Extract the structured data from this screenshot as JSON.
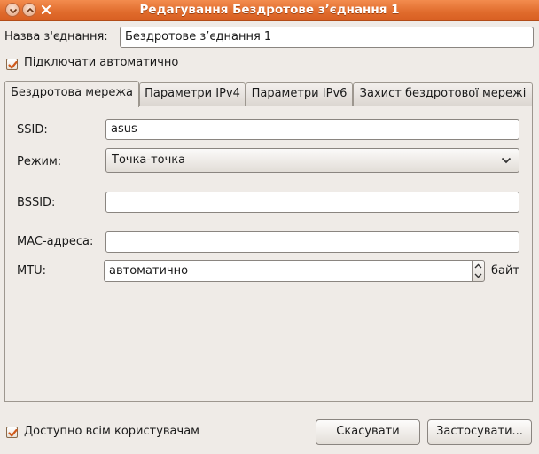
{
  "window": {
    "title": "Редагування Бездротове з’єднання 1"
  },
  "connection": {
    "name_label": "Назва з'єднання:",
    "name_value": "Бездротове з’єднання 1",
    "autoconnect_label": "Підключати автоматично",
    "autoconnect_checked": true
  },
  "tabs": [
    {
      "label": "Бездротова мережа",
      "active": true
    },
    {
      "label": "Параметри IPv4",
      "active": false
    },
    {
      "label": "Параметри IPv6",
      "active": false
    },
    {
      "label": "Захист бездротової мережі",
      "active": false
    }
  ],
  "wireless": {
    "ssid_label": "SSID:",
    "ssid_value": "asus",
    "mode_label": "Режим:",
    "mode_value": "Точка-точка",
    "bssid_label": "BSSID:",
    "bssid_value": "",
    "mac_label": "MAC-адреса:",
    "mac_value": "",
    "mtu_label": "MTU:",
    "mtu_value": "автоматично",
    "mtu_unit": "байт"
  },
  "footer": {
    "all_users_label": "Доступно всім користувачам",
    "all_users_checked": true,
    "cancel_label": "Скасувати",
    "apply_label": "Застосувати..."
  },
  "colors": {
    "titlebar": "#e06b2c",
    "check": "#d05a1c"
  }
}
